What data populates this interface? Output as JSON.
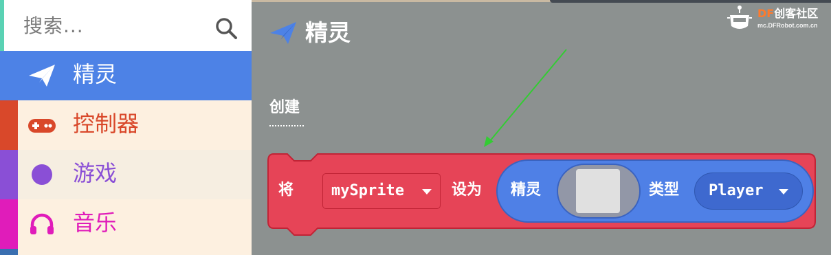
{
  "search": {
    "placeholder": "搜索..."
  },
  "categories": [
    {
      "label": "精灵",
      "icon": "paper-plane-icon",
      "color": "#4d82e6",
      "selected": true
    },
    {
      "label": "控制器",
      "icon": "gamepad-icon",
      "color": "#d9482a"
    },
    {
      "label": "游戏",
      "icon": "circle-icon",
      "color": "#8a4fd6"
    },
    {
      "label": "音乐",
      "icon": "headphones-icon",
      "color": "#e01cba"
    }
  ],
  "flyout": {
    "title": "精灵",
    "section": "创建",
    "block": {
      "prefix": "将",
      "variable": "mySprite",
      "set_as": "设为",
      "sprite_label": "精灵",
      "type_label": "类型",
      "kind": "Player",
      "block_color": "#e64457",
      "sprite_color": "#4f80e6"
    }
  },
  "watermark": {
    "brand_df": "DF",
    "brand_cn": "创客社区",
    "url": "mc.DFRobot.com.cn"
  },
  "annotation": {
    "arrow_color": "#33cc33"
  }
}
